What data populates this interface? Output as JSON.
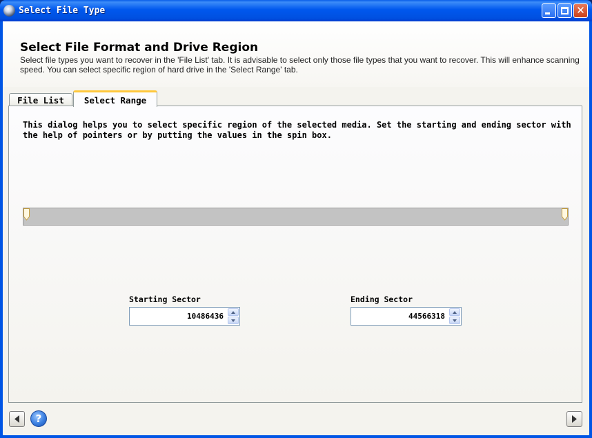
{
  "window": {
    "title": "Select File Type"
  },
  "header": {
    "heading": "Select File Format and Drive Region",
    "description": "Select file types you want to recover in the 'File List' tab. It is advisable to select only those file types that you want to recover. This will enhance scanning speed. You can select specific region of hard drive in the 'Select Range' tab."
  },
  "tabs": [
    {
      "label": "File List",
      "active": false
    },
    {
      "label": "Select Range",
      "active": true
    }
  ],
  "select_range": {
    "instructions": "This dialog helps you to select specific region of the selected media. Set the starting and ending sector with the help of pointers or by putting the values in the spin box.",
    "start_pointer_fraction": 0.0,
    "end_pointer_fraction": 1.0,
    "starting_sector": {
      "label": "Starting Sector",
      "value": "10486436"
    },
    "ending_sector": {
      "label": "Ending Sector",
      "value": "44566318"
    }
  },
  "footer": {
    "back_icon": "left-arrow-icon",
    "help_icon": "help-icon",
    "next_icon": "right-arrow-icon"
  },
  "colors": {
    "titlebar": "#0058ee",
    "active_tab_highlight": "#ffc83c",
    "range_bar": "#c3c3c3"
  }
}
